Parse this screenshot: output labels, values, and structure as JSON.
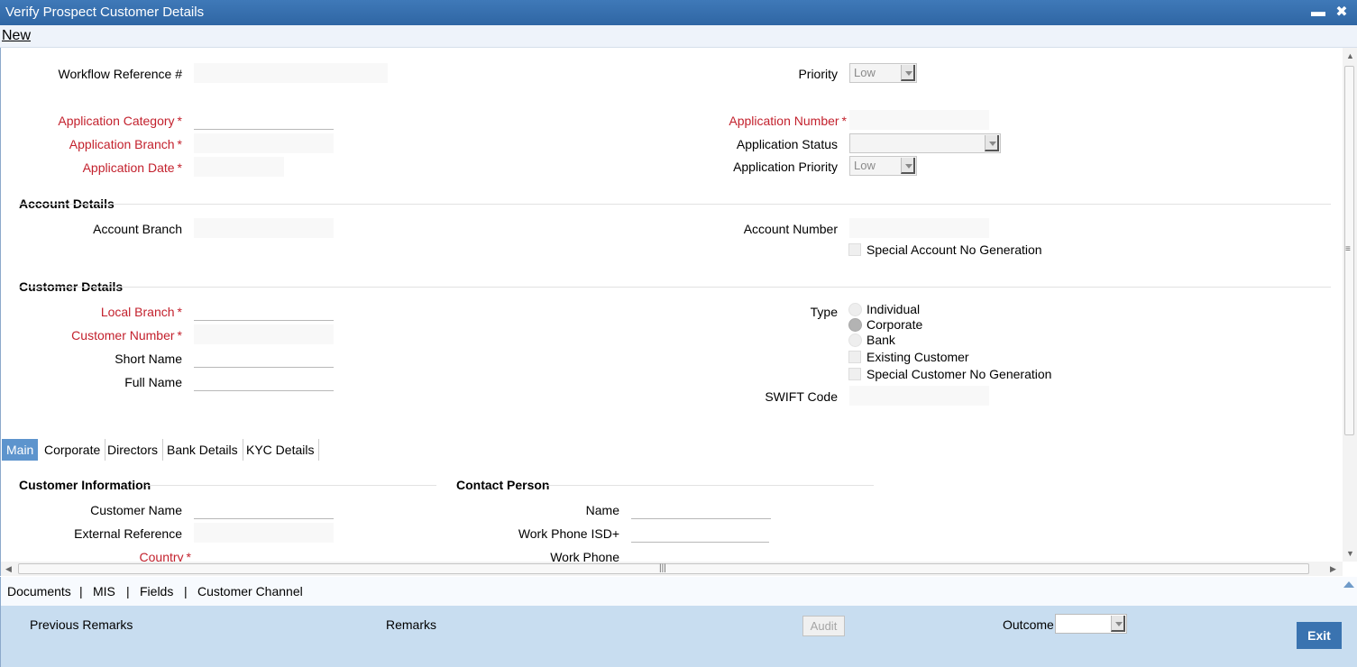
{
  "window": {
    "title": "Verify Prospect Customer Details",
    "minimize_glyph": "▬",
    "close_glyph": "✖"
  },
  "toolbar": {
    "new_label": "New"
  },
  "header": {
    "workflow_ref_label": "Workflow Reference #",
    "priority_label": "Priority",
    "priority_value": "Low",
    "app_category_label": "Application Category",
    "app_branch_label": "Application Branch",
    "app_date_label": "Application Date",
    "app_number_label": "Application Number",
    "app_status_label": "Application Status",
    "app_status_value": "",
    "app_priority_label": "Application Priority",
    "app_priority_value": "Low",
    "required_mark": "*"
  },
  "account_details": {
    "section_title": "Account Details",
    "account_branch_label": "Account Branch",
    "account_number_label": "Account Number",
    "special_account_label": "Special Account No Generation"
  },
  "customer_details": {
    "section_title": "Customer Details",
    "local_branch_label": "Local Branch",
    "customer_number_label": "Customer Number",
    "short_name_label": "Short Name",
    "full_name_label": "Full Name",
    "type_label": "Type",
    "type_options": [
      "Individual",
      "Corporate",
      "Bank"
    ],
    "type_selected": "Corporate",
    "existing_customer_label": "Existing Customer",
    "special_customer_label": "Special Customer No Generation",
    "swift_code_label": "SWIFT Code"
  },
  "tabs": [
    {
      "label": "Main",
      "active": true
    },
    {
      "label": "Corporate",
      "active": false
    },
    {
      "label": "Directors",
      "active": false
    },
    {
      "label": "Bank Details",
      "active": false
    },
    {
      "label": "KYC Details",
      "active": false
    }
  ],
  "customer_information": {
    "section_title": "Customer Information",
    "customer_name_label": "Customer Name",
    "external_reference_label": "External Reference",
    "country_label": "Country"
  },
  "contact_person": {
    "section_title": "Contact Person",
    "name_label": "Name",
    "work_phone_isd_label": "Work Phone ISD+",
    "work_phone_label": "Work Phone"
  },
  "footer_links": [
    "Documents",
    "MIS",
    "Fields",
    "Customer Channel"
  ],
  "footer_separator": "|",
  "bottom_bar": {
    "previous_remarks_label": "Previous Remarks",
    "remarks_label": "Remarks",
    "audit_label": "Audit",
    "outcome_label": "Outcome",
    "outcome_value": "",
    "exit_label": "Exit"
  },
  "colors": {
    "title_bar": "#2f66a4",
    "required_label": "#c3212d",
    "active_tab": "#5d94cd",
    "bottom_bar": "#c8ddf0",
    "exit_button": "#3a73b0"
  }
}
